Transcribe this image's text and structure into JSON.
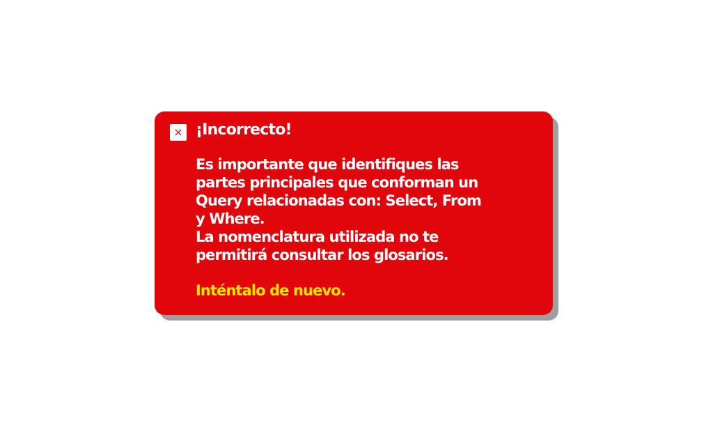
{
  "feedback": {
    "title": "¡Incorrecto!",
    "lines": [
      "Es importante que identifiques las",
      "partes principales que conforman un",
      "Query relacionadas con: Select, From",
      "y Where.",
      "La nomenclatura utilizada no te",
      "permitirá consultar los glosarios."
    ],
    "retry": "Inténtalo de nuevo.",
    "icon": "close-icon"
  },
  "colors": {
    "dialog_background": "#e0060c",
    "shadow": "#9e9e9e",
    "text": "#ffffff",
    "retry_text": "#ffe600",
    "close_icon": "#e0060c"
  }
}
